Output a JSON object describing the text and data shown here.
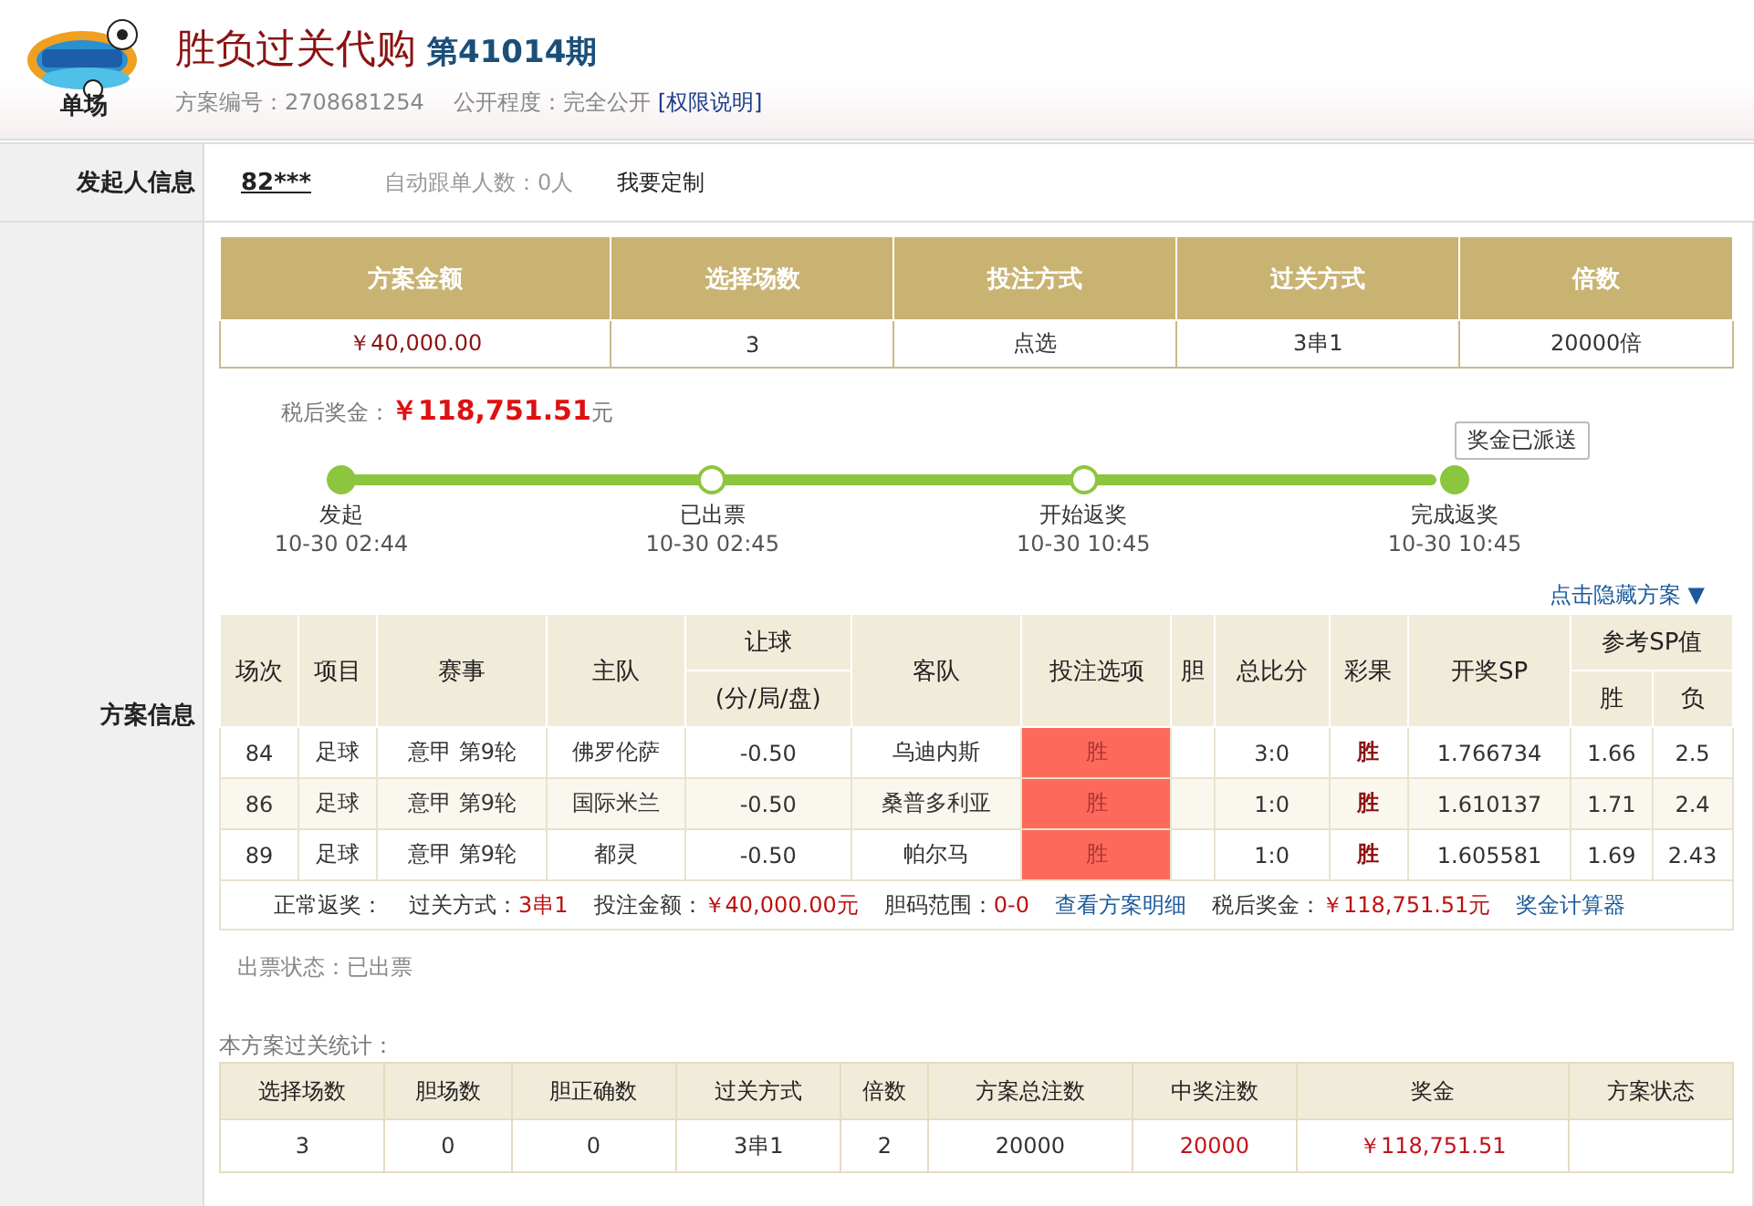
{
  "header": {
    "logo_text": "单场",
    "title": "胜负过关代购",
    "issue": "第41014期",
    "plan_no_label": "方案编号：",
    "plan_no": "2708681254",
    "visibility_label": "公开程度：",
    "visibility": "完全公开",
    "permission_link": "[权限说明]"
  },
  "initiator": {
    "label": "发起人信息",
    "user": "82***",
    "auto_follow": "自动跟单人数：0人",
    "customize": "我要定制"
  },
  "section_label": "方案信息",
  "summary": {
    "columns": [
      "方案金额",
      "选择场数",
      "投注方式",
      "过关方式",
      "倍数"
    ],
    "values": [
      {
        "text": "￥40,000.00",
        "kind": "money"
      },
      {
        "text": "3",
        "kind": "plain"
      },
      {
        "text": "点选",
        "kind": "plain"
      },
      {
        "text": "3串1",
        "kind": "plain"
      },
      {
        "text": "20000倍",
        "kind": "plain"
      }
    ]
  },
  "prize": {
    "label": "税后奖金：",
    "amount": "￥118,751.51",
    "unit": "元"
  },
  "dispatch_button": "奖金已派送",
  "steps": [
    {
      "label": "发起",
      "time": "10-30 02:44",
      "filled": true
    },
    {
      "label": "已出票",
      "time": "10-30 02:45",
      "filled": false
    },
    {
      "label": "开始返奖",
      "time": "10-30 10:45",
      "filled": false
    },
    {
      "label": "完成返奖",
      "time": "10-30 10:45",
      "filled": true
    }
  ],
  "toggle_link": "点击隐藏方案 ▼",
  "detail": {
    "columns": [
      {
        "label": "场次"
      },
      {
        "label": "项目"
      },
      {
        "label": "赛事"
      },
      {
        "label": "主队"
      },
      {
        "label": "让球",
        "sub": "(分/局/盘)"
      },
      {
        "label": "客队"
      },
      {
        "label": "投注选项"
      },
      {
        "label": "胆"
      },
      {
        "label": "总比分"
      },
      {
        "label": "彩果"
      },
      {
        "label": "开奖SP"
      },
      {
        "label": "参考SP值",
        "children": [
          "胜",
          "负"
        ]
      }
    ],
    "rows": [
      {
        "no": "84",
        "sport": "足球",
        "league": "意甲 第9轮",
        "home": "佛罗伦萨",
        "handicap": "-0.50",
        "away": "乌迪内斯",
        "bet": {
          "text": "胜",
          "selected": true
        },
        "score": "3:0",
        "result": "胜",
        "sp": "1.766734",
        "sp_win": "1.66",
        "sp_lose": "2.5"
      },
      {
        "no": "86",
        "sport": "足球",
        "league": "意甲 第9轮",
        "home": "国际米兰",
        "handicap": "-0.50",
        "away": "桑普多利亚",
        "bet": {
          "text": "胜",
          "selected": true
        },
        "score": "1:0",
        "result": "胜",
        "sp": "1.610137",
        "sp_win": "1.71",
        "sp_lose": "2.4"
      },
      {
        "no": "89",
        "sport": "足球",
        "league": "意甲 第9轮",
        "home": "都灵",
        "handicap": "-0.50",
        "away": "帕尔马",
        "bet": {
          "text": "胜",
          "selected": true
        },
        "score": "1:0",
        "result": "胜",
        "sp": "1.605581",
        "sp_win": "1.69",
        "sp_lose": "2.43"
      }
    ],
    "footer": [
      {
        "kind": "label",
        "text": "正常返奖："
      },
      {
        "kind": "pair",
        "label": "过关方式：",
        "value": "3串1"
      },
      {
        "kind": "pair",
        "label": "投注金额：",
        "value": "￥40,000.00元"
      },
      {
        "kind": "pair",
        "label": "胆码范围：",
        "value": "0-0"
      },
      {
        "kind": "link",
        "text": "查看方案明细"
      },
      {
        "kind": "pair",
        "label": "税后奖金：",
        "value": "￥118,751.51元"
      },
      {
        "kind": "link",
        "text": "奖金计算器"
      }
    ]
  },
  "ticket_status": "出票状态：已出票",
  "stats": {
    "title": "本方案过关统计：",
    "columns": [
      "选择场数",
      "胆场数",
      "胆正确数",
      "过关方式",
      "倍数",
      "方案总注数",
      "中奖注数",
      "奖金",
      "方案状态"
    ],
    "values": [
      {
        "text": "3",
        "kind": "plain"
      },
      {
        "text": "0",
        "kind": "plain"
      },
      {
        "text": "0",
        "kind": "plain"
      },
      {
        "text": "3串1",
        "kind": "plain"
      },
      {
        "text": "2",
        "kind": "plain"
      },
      {
        "text": "20000",
        "kind": "plain"
      },
      {
        "text": "20000",
        "kind": "money"
      },
      {
        "text": "￥118,751.51",
        "kind": "money"
      }
    ]
  }
}
